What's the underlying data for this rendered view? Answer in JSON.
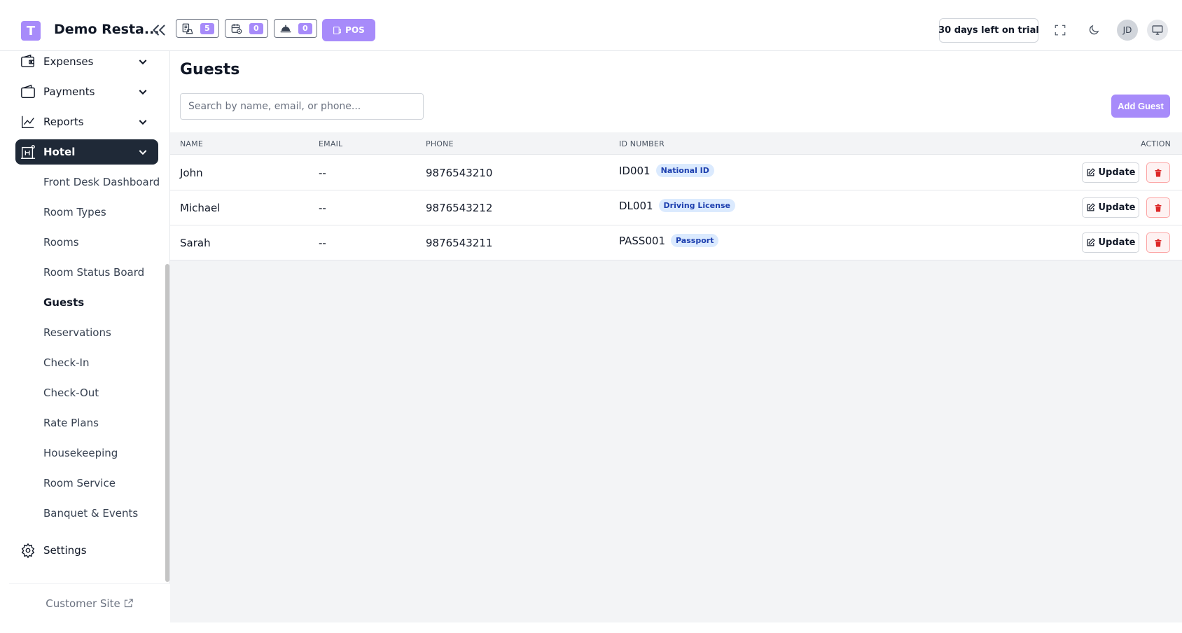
{
  "app": {
    "logo_letter": "T",
    "brand": "Demo Resta...",
    "counters": [
      {
        "icon": "orders-icon",
        "count": "5"
      },
      {
        "icon": "calendar-check-icon",
        "count": "0"
      },
      {
        "icon": "room-service-bell-icon",
        "count": "0"
      }
    ],
    "pos_label": "POS",
    "trial_label": "30 days left on trial",
    "avatar_initials": "JD",
    "accent": "#a78bfa"
  },
  "sidebar": {
    "main_items": [
      {
        "label": "Expenses",
        "icon": "wallet-icon"
      },
      {
        "label": "Payments",
        "icon": "card-icon"
      },
      {
        "label": "Reports",
        "icon": "chart-line-icon"
      },
      {
        "label": "Hotel",
        "icon": "hotel-icon",
        "active": true
      }
    ],
    "hotel_sub_items": [
      "Front Desk Dashboard",
      "Room Types",
      "Rooms",
      "Room Status Board",
      "Guests",
      "Reservations",
      "Check-In",
      "Check-Out",
      "Rate Plans",
      "Housekeeping",
      "Room Service",
      "Banquet & Events"
    ],
    "current_sub_item": "Guests",
    "settings_label": "Settings",
    "footer_label": "Customer Site"
  },
  "main": {
    "title": "Guests",
    "search_placeholder": "Search by name, email, or phone...",
    "add_label": "Add Guest",
    "columns": [
      "NAME",
      "EMAIL",
      "PHONE",
      "ID NUMBER",
      "ACTION"
    ],
    "rows": [
      {
        "name": "John",
        "email": "--",
        "phone": "9876543210",
        "id_number": "ID001",
        "id_type": "National ID"
      },
      {
        "name": "Michael",
        "email": "--",
        "phone": "9876543212",
        "id_number": "DL001",
        "id_type": "Driving License"
      },
      {
        "name": "Sarah",
        "email": "--",
        "phone": "9876543211",
        "id_number": "PASS001",
        "id_type": "Passport"
      }
    ],
    "update_label": "Update"
  }
}
